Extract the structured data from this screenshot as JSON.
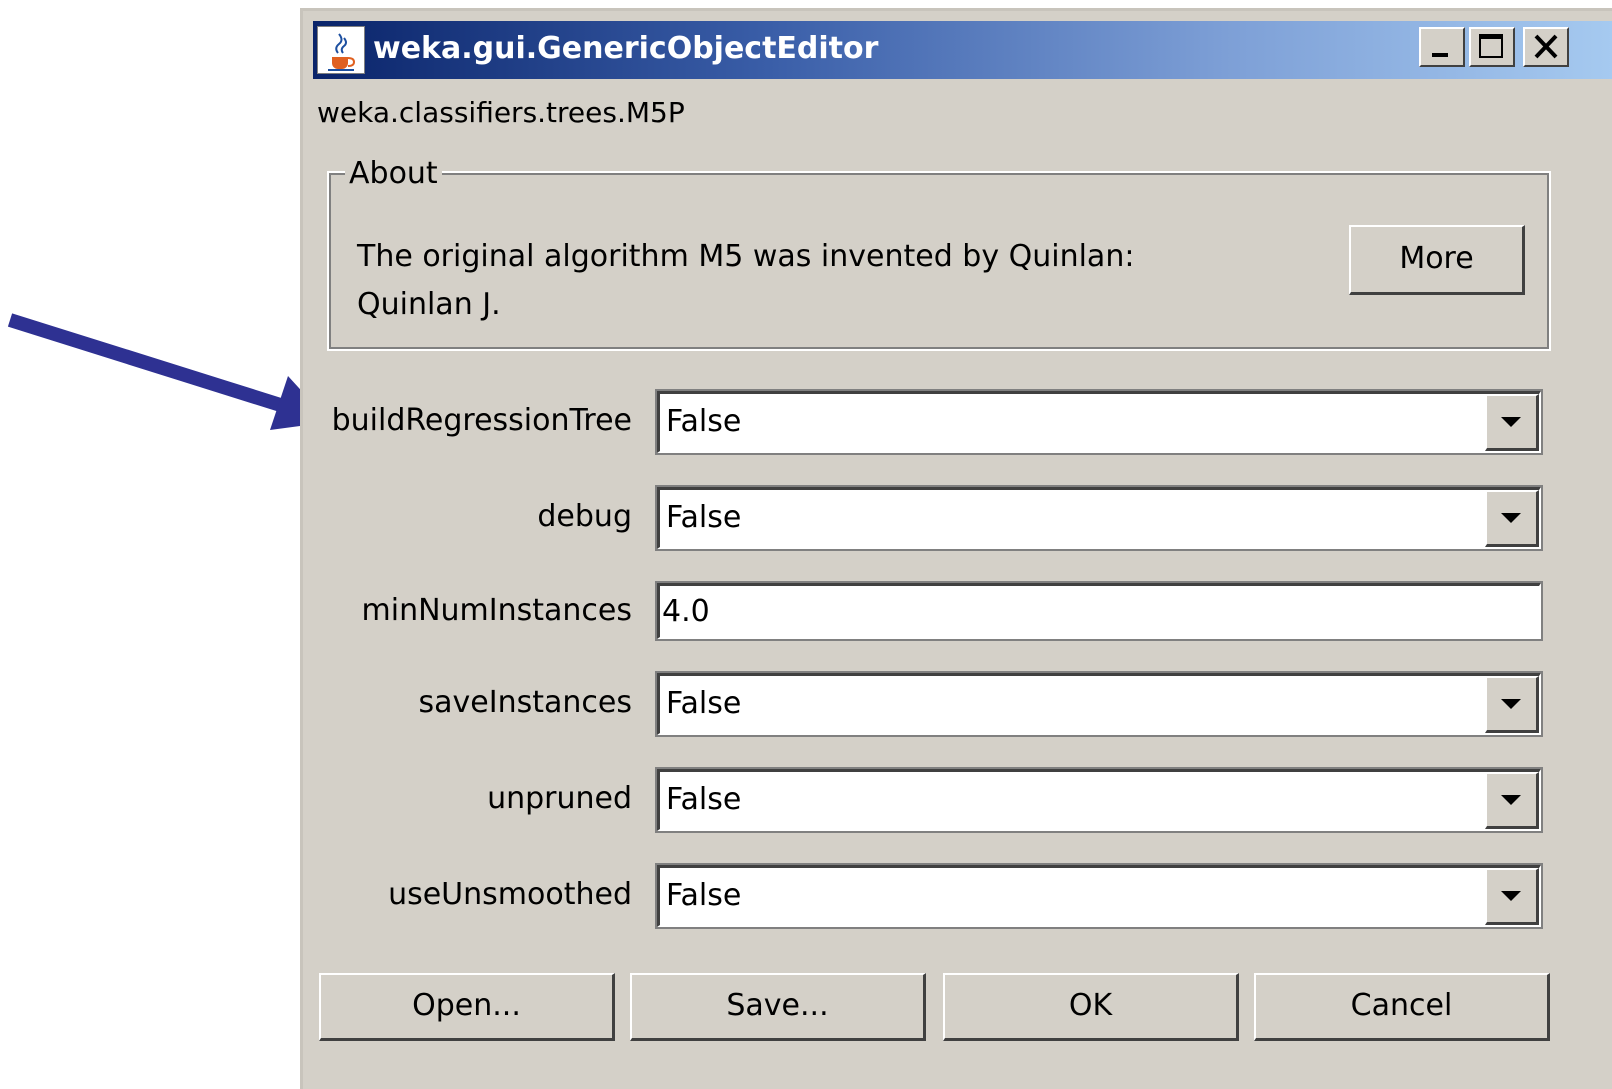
{
  "window": {
    "title": "weka.gui.GenericObjectEditor",
    "controls": {
      "minimize_icon": "minimize-icon",
      "maximize_icon": "maximize-icon",
      "close_icon": "close-icon"
    },
    "app_icon": "java-cup-icon"
  },
  "editor": {
    "class_name": "weka.classifiers.trees.M5P",
    "about": {
      "legend": "About",
      "line1": "The original algorithm M5 was invented by Quinlan:",
      "line2": "Quinlan J.",
      "more_label": "More"
    },
    "properties": [
      {
        "label": "buildRegressionTree",
        "value": "False",
        "kind": "dropdown"
      },
      {
        "label": "debug",
        "value": "False",
        "kind": "dropdown"
      },
      {
        "label": "minNumInstances",
        "value": "4.0",
        "kind": "text"
      },
      {
        "label": "saveInstances",
        "value": "False",
        "kind": "dropdown"
      },
      {
        "label": "unpruned",
        "value": "False",
        "kind": "dropdown"
      },
      {
        "label": "useUnsmoothed",
        "value": "False",
        "kind": "dropdown"
      }
    ],
    "buttons": {
      "open": "Open...",
      "save": "Save...",
      "ok": "OK",
      "cancel": "Cancel"
    }
  },
  "annotation": {
    "arrow_icon": "pointer-arrow-icon",
    "arrow_color": "#2e3192"
  },
  "colors": {
    "panel_bg": "#d4d0c8",
    "titlebar_start": "#0a246a",
    "titlebar_end": "#a6caf0"
  }
}
